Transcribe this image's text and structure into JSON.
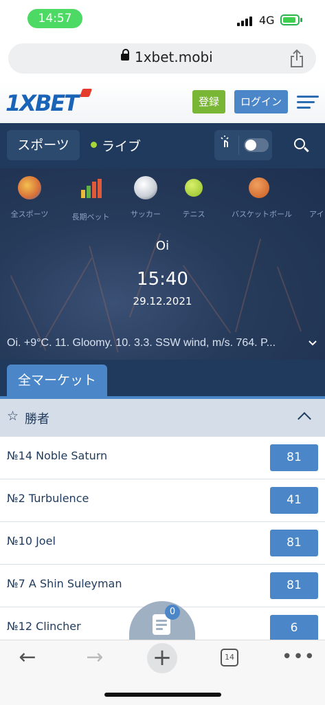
{
  "status": {
    "time": "14:57",
    "network": "4G"
  },
  "browser": {
    "url": "1xbet.mobi",
    "tabs_count": "14"
  },
  "header": {
    "logo": "1XBET",
    "register_label": "登録",
    "login_label": "ログイン"
  },
  "nav": {
    "sports_label": "スポーツ",
    "live_label": "ライブ"
  },
  "categories": [
    {
      "label": "全スポーツ"
    },
    {
      "label": "長期ベット"
    },
    {
      "label": "サッカー"
    },
    {
      "label": "テニス"
    },
    {
      "label": "バスケットボール"
    },
    {
      "label": "アイ"
    }
  ],
  "event": {
    "name": "Oi",
    "time": "15:40",
    "date": "29.12.2021",
    "weather": "Oi. +9°C. 11. Gloomy. 10. 3.3. SSW wind, m/s. 764. P..."
  },
  "market_tab": "全マーケット",
  "group": {
    "title": "勝者",
    "rows": [
      {
        "name": "№14 Noble Saturn",
        "odd": "81"
      },
      {
        "name": "№2 Turbulence",
        "odd": "41"
      },
      {
        "name": "№10 Joel",
        "odd": "81"
      },
      {
        "name": "№7 A Shin Suleyman",
        "odd": "81"
      },
      {
        "name": "№12 Clincher",
        "odd": "6"
      }
    ]
  },
  "betslip": {
    "count": "0"
  },
  "colors": {
    "brand_blue": "#4a86c8",
    "nav_dark": "#1f3a5c",
    "register_green": "#7ab636",
    "status_green": "#4cd964"
  }
}
